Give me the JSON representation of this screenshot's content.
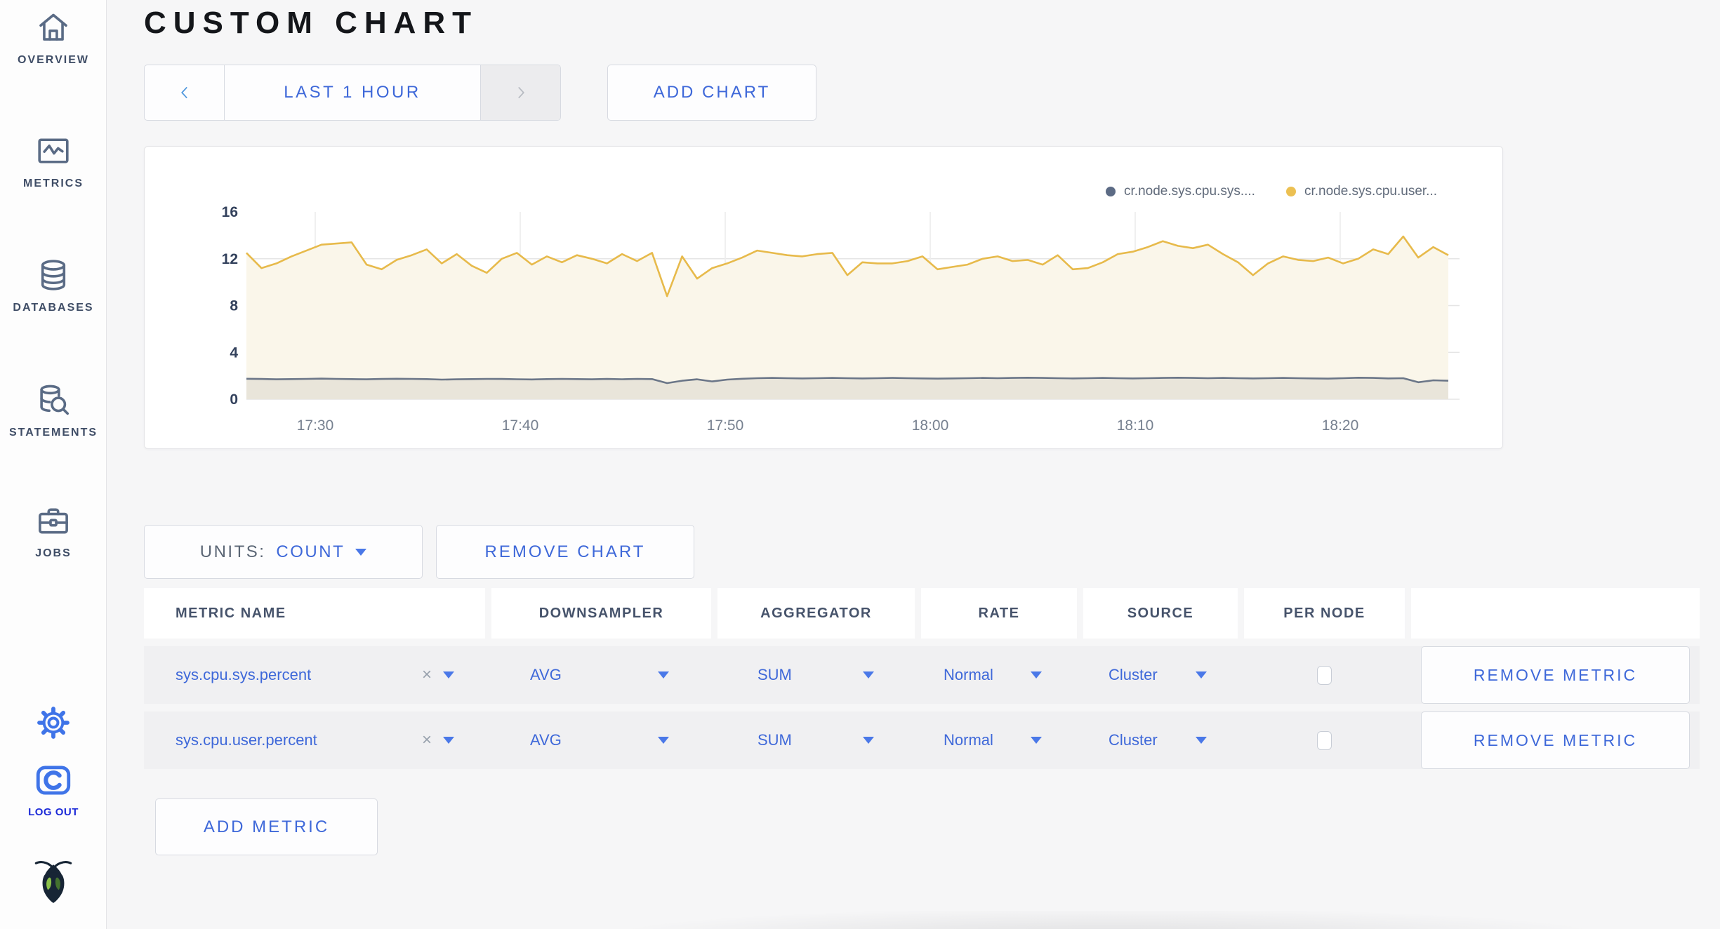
{
  "colors": {
    "accent_blue": "#3e68d9",
    "slate": "#46536b",
    "logout_blue": "#1d2bd8",
    "icon_blue": "#3f74e8",
    "series_sys": "#6b7688",
    "series_user": "#e7ba4b"
  },
  "page": {
    "title": "CUSTOM CHART"
  },
  "sidebar": {
    "items": [
      {
        "icon": "home-icon",
        "label": "OVERVIEW"
      },
      {
        "icon": "metrics-icon",
        "label": "METRICS"
      },
      {
        "icon": "databases-icon",
        "label": "DATABASES"
      },
      {
        "icon": "statements-icon",
        "label": "STATEMENTS"
      },
      {
        "icon": "jobs-icon",
        "label": "JOBS"
      }
    ],
    "logout_label": "LOG OUT"
  },
  "toolbar": {
    "time_range_label": "LAST 1 HOUR",
    "add_chart_label": "ADD CHART"
  },
  "chart_controls": {
    "units_label": "UNITS:",
    "units_value": "COUNT",
    "remove_chart_label": "REMOVE CHART",
    "add_metric_label": "ADD METRIC"
  },
  "chart_data": {
    "type": "line",
    "x_ticks": [
      "17:30",
      "17:40",
      "17:50",
      "18:00",
      "18:10",
      "18:20"
    ],
    "y_ticks": [
      0,
      4,
      8,
      12,
      16
    ],
    "ylim": [
      0,
      16
    ],
    "x_range": "last 1 hour (~17:26 - 18:26)",
    "grid": true,
    "legend_position": "top-right",
    "series": [
      {
        "name": "cr.node.sys.cpu.sys.percent",
        "legend_label": "cr.node.sys.cpu.sys....",
        "color": "#5c6b85",
        "line_color": "#6b7688",
        "fill_color": "#e9e5da",
        "values": [
          1.75,
          1.73,
          1.7,
          1.72,
          1.74,
          1.76,
          1.74,
          1.72,
          1.7,
          1.73,
          1.75,
          1.74,
          1.72,
          1.68,
          1.7,
          1.72,
          1.74,
          1.73,
          1.71,
          1.69,
          1.72,
          1.74,
          1.72,
          1.7,
          1.73,
          1.71,
          1.74,
          1.72,
          1.38,
          1.58,
          1.7,
          1.52,
          1.68,
          1.75,
          1.8,
          1.82,
          1.8,
          1.78,
          1.8,
          1.82,
          1.8,
          1.78,
          1.8,
          1.82,
          1.8,
          1.78,
          1.76,
          1.78,
          1.8,
          1.82,
          1.8,
          1.82,
          1.84,
          1.82,
          1.8,
          1.78,
          1.8,
          1.82,
          1.8,
          1.78,
          1.8,
          1.82,
          1.84,
          1.82,
          1.8,
          1.82,
          1.8,
          1.78,
          1.8,
          1.82,
          1.8,
          1.78,
          1.76,
          1.8,
          1.84,
          1.82,
          1.78,
          1.8,
          1.45,
          1.62,
          1.58
        ]
      },
      {
        "name": "cr.node.sys.cpu.user.percent",
        "legend_label": "cr.node.sys.cpu.user...",
        "color": "#ecc052",
        "line_color": "#e7ba4b",
        "fill_color": "#faf6ea",
        "values": [
          12.5,
          11.2,
          11.6,
          12.2,
          12.7,
          13.2,
          13.3,
          13.4,
          11.5,
          11.1,
          11.9,
          12.3,
          12.8,
          11.6,
          12.4,
          11.4,
          10.8,
          12.0,
          12.5,
          11.5,
          12.2,
          11.7,
          12.3,
          12.0,
          11.6,
          12.4,
          11.8,
          12.5,
          8.8,
          12.2,
          10.3,
          11.2,
          11.6,
          12.1,
          12.7,
          12.5,
          12.3,
          12.2,
          12.4,
          12.5,
          10.6,
          11.7,
          11.6,
          11.6,
          11.8,
          12.2,
          11.1,
          11.3,
          11.5,
          12.0,
          12.2,
          11.8,
          11.9,
          11.5,
          12.3,
          11.1,
          11.2,
          11.7,
          12.4,
          12.6,
          13.0,
          13.5,
          13.1,
          12.9,
          13.2,
          12.4,
          11.7,
          10.6,
          11.6,
          12.2,
          11.9,
          11.8,
          12.1,
          11.6,
          12.0,
          12.8,
          12.4,
          13.9,
          12.1,
          13.0,
          12.3
        ]
      }
    ]
  },
  "table": {
    "headers": [
      "METRIC NAME",
      "DOWNSAMPLER",
      "AGGREGATOR",
      "RATE",
      "SOURCE",
      "PER NODE",
      ""
    ],
    "clear_glyph": "×",
    "rows": [
      {
        "metric_name": "sys.cpu.sys.percent",
        "downsampler": "AVG",
        "aggregator": "SUM",
        "rate": "Normal",
        "source": "Cluster",
        "per_node_checked": false,
        "remove_label": "REMOVE METRIC"
      },
      {
        "metric_name": "sys.cpu.user.percent",
        "downsampler": "AVG",
        "aggregator": "SUM",
        "rate": "Normal",
        "source": "Cluster",
        "per_node_checked": false,
        "remove_label": "REMOVE METRIC"
      }
    ]
  }
}
